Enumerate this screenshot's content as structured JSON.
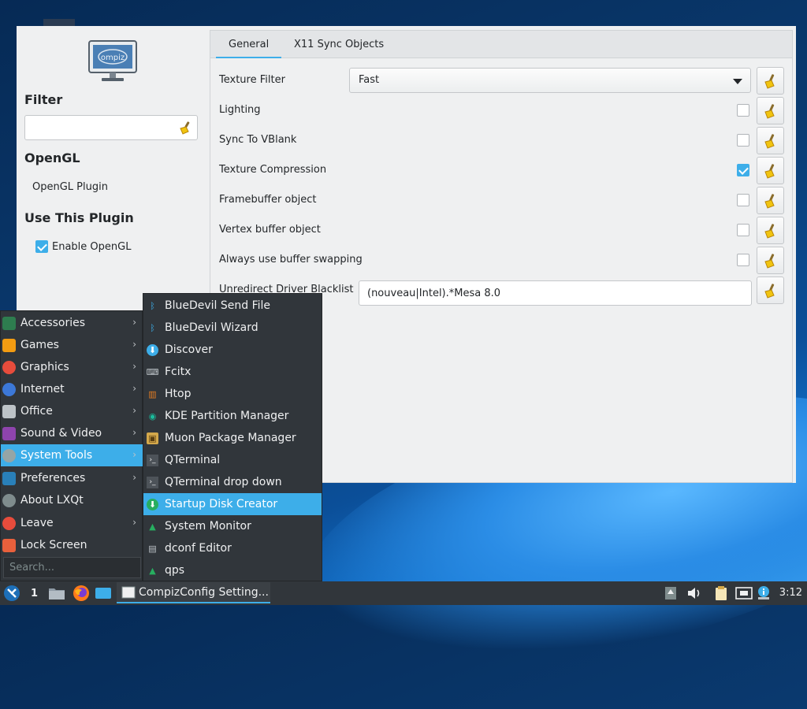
{
  "window": {
    "sidebar": {
      "filter_heading": "Filter",
      "filter_value": "",
      "plugin_heading": "OpenGL",
      "plugin_name": "OpenGL Plugin",
      "use_heading": "Use This Plugin",
      "enable_label": "Enable OpenGL",
      "enable_checked": true
    },
    "tabs": [
      {
        "label": "General",
        "active": true
      },
      {
        "label": "X11 Sync Objects",
        "active": false
      }
    ],
    "options": {
      "texture_filter": {
        "label": "Texture Filter",
        "value": "Fast"
      },
      "lighting": {
        "label": "Lighting",
        "checked": false
      },
      "sync_vblank": {
        "label": "Sync To VBlank",
        "checked": false
      },
      "texture_compression": {
        "label": "Texture Compression",
        "checked": true
      },
      "framebuffer": {
        "label": "Framebuffer object",
        "checked": false
      },
      "vertex_buffer": {
        "label": "Vertex buffer object",
        "checked": false
      },
      "buffer_swapping": {
        "label": "Always use buffer swapping",
        "checked": false
      },
      "driver_blacklist": {
        "label": "Unredirect Driver Blacklist",
        "value": "(nouveau|Intel).*Mesa 8.0"
      }
    }
  },
  "menu": {
    "items": [
      {
        "label": "Accessories",
        "icon": "accessories-icon",
        "color": "#2e7d4f",
        "submenu": true
      },
      {
        "label": "Games",
        "icon": "games-icon",
        "color": "#f39c12",
        "submenu": true
      },
      {
        "label": "Graphics",
        "icon": "graphics-icon",
        "color": "#e74c3c",
        "submenu": true
      },
      {
        "label": "Internet",
        "icon": "internet-icon",
        "color": "#3c78d8",
        "submenu": true
      },
      {
        "label": "Office",
        "icon": "office-icon",
        "color": "#bdc3c7",
        "submenu": true
      },
      {
        "label": "Sound & Video",
        "icon": "sound-video-icon",
        "color": "#8e44ad",
        "submenu": true
      },
      {
        "label": "System Tools",
        "icon": "system-tools-icon",
        "color": "#95a5a6",
        "submenu": true
      },
      {
        "label": "Preferences",
        "icon": "preferences-icon",
        "color": "#2980b9",
        "submenu": true
      },
      {
        "label": "About LXQt",
        "icon": "info-icon",
        "color": "#7f8c8d",
        "submenu": false
      },
      {
        "label": "Leave",
        "icon": "power-icon",
        "color": "#e74c3c",
        "submenu": true
      },
      {
        "label": "Lock Screen",
        "icon": "lock-icon",
        "color": "#e8603c",
        "submenu": false
      }
    ],
    "search_placeholder": "Search...",
    "submenu_items": [
      {
        "label": "BlueDevil Send File",
        "icon": "bluetooth-icon",
        "color": "#3daee9",
        "glyph": "ᛒ"
      },
      {
        "label": "BlueDevil Wizard",
        "icon": "bluetooth-icon",
        "color": "#3daee9",
        "glyph": "ᛒ"
      },
      {
        "label": "Discover",
        "icon": "discover-icon",
        "color": "#3daee9",
        "glyph": "⬇"
      },
      {
        "label": "Fcitx",
        "icon": "keyboard-icon",
        "color": "#bdc3c7",
        "glyph": "⌨"
      },
      {
        "label": "Htop",
        "icon": "htop-icon",
        "color": "#e67e22",
        "glyph": "▥"
      },
      {
        "label": "KDE Partition Manager",
        "icon": "partition-icon",
        "color": "#1abc9c",
        "glyph": "◉"
      },
      {
        "label": "Muon Package Manager",
        "icon": "package-icon",
        "color": "#d4a84b",
        "glyph": "▣"
      },
      {
        "label": "QTerminal",
        "icon": "terminal-icon",
        "color": "#4d5359",
        "glyph": "›_"
      },
      {
        "label": "QTerminal drop down",
        "icon": "terminal-icon",
        "color": "#4d5359",
        "glyph": "›_"
      },
      {
        "label": "Startup Disk Creator",
        "icon": "startup-disk-icon",
        "color": "#27ae60",
        "glyph": "⬇"
      },
      {
        "label": "System Monitor",
        "icon": "system-monitor-icon",
        "color": "#27ae60",
        "glyph": "▲"
      },
      {
        "label": "dconf Editor",
        "icon": "dconf-icon",
        "color": "#bdc3c7",
        "glyph": "▤"
      },
      {
        "label": "qps",
        "icon": "qps-icon",
        "color": "#27ae60",
        "glyph": "▲"
      }
    ]
  },
  "taskbar": {
    "desktop_number": "1",
    "window_title": "CompizConfig Setting...",
    "clock": "3:12"
  }
}
